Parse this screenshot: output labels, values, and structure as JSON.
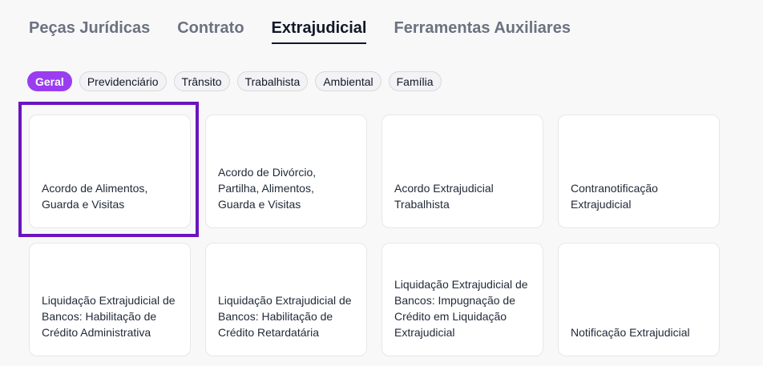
{
  "tabs": [
    {
      "label": "Peças Jurídicas",
      "active": false
    },
    {
      "label": "Contrato",
      "active": false
    },
    {
      "label": "Extrajudicial",
      "active": true
    },
    {
      "label": "Ferramentas Auxiliares",
      "active": false
    }
  ],
  "filters": [
    {
      "label": "Geral",
      "active": true
    },
    {
      "label": "Previdenciário",
      "active": false
    },
    {
      "label": "Trânsito",
      "active": false
    },
    {
      "label": "Trabalhista",
      "active": false
    },
    {
      "label": "Ambiental",
      "active": false
    },
    {
      "label": "Família",
      "active": false
    }
  ],
  "cards": [
    {
      "title": "Acordo de Alimentos, Guarda e Visitas"
    },
    {
      "title": "Acordo de Divórcio, Partilha, Alimentos, Guarda e Visitas"
    },
    {
      "title": "Acordo Extrajudicial Trabalhista"
    },
    {
      "title": "Contranotificação Extrajudicial"
    },
    {
      "title": "Liquidação Extrajudicial de Bancos: Habilitação de Crédito Administrativa"
    },
    {
      "title": "Liquidação Extrajudicial de Bancos: Habilitação de Crédito Retardatária"
    },
    {
      "title": "Liquidação Extrajudicial de Bancos: Impugnação de Crédito em Liquidação Extrajudicial"
    },
    {
      "title": "Notificação Extrajudicial"
    }
  ],
  "colors": {
    "accent": "#9a3df0",
    "highlight": "#6a15bf"
  }
}
